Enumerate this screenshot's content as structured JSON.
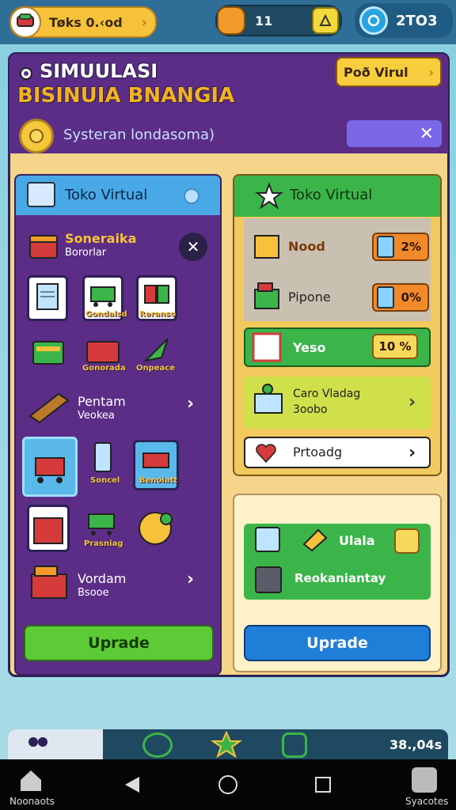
{
  "top": {
    "coins_label": "Tøks 0.‹od",
    "energy_value": "11",
    "gems_value": "2TO3"
  },
  "header": {
    "title_line1": "SIMUULASI",
    "title_line2": "BISINUIA BNANGIA",
    "virtual_button": "Poð Virul",
    "system_text": "Systeran londasoma)"
  },
  "left": {
    "header": "Toko Virtual",
    "item1_title": "Soneraika",
    "item1_sub": "Bororlar",
    "tiles_row1_labels": [
      "",
      "Gondalsd",
      "Reranso"
    ],
    "tiles_row2_labels": [
      "",
      "Gonorada",
      "Onpeace"
    ],
    "item2_title": "Pentam",
    "item2_sub": "Veokea",
    "tiles_row3_labels": [
      "",
      "Soncel",
      "Benoiatt"
    ],
    "tiles_row4_labels": [
      "",
      "Prasniag",
      ""
    ],
    "item3_title": "Vordam",
    "item3_sub": "Bsooe",
    "upgrade": "Uprade"
  },
  "right": {
    "header": "Toko Virtual",
    "row1_label": "Nood",
    "row1_pct": "2%",
    "row2_label": "Pipone",
    "row2_pct": "0%",
    "row3_label": "Yeso",
    "row3_pct": "10 %",
    "row4_title": "Caro Vladag",
    "row4_sub": "3oobo",
    "row5_label": "Prtoadg",
    "card_label1": "Ulala",
    "card_label2": "Reokaniantay",
    "upgrade": "Uprade"
  },
  "bottom": {
    "value": "38.,04s",
    "nav_left": "Noonaots",
    "nav_right": "Syacotes"
  },
  "colors": {
    "purple": "#5b2d86",
    "gold": "#f6c23a",
    "green": "#3bb54a",
    "blue": "#1f7fd8"
  }
}
